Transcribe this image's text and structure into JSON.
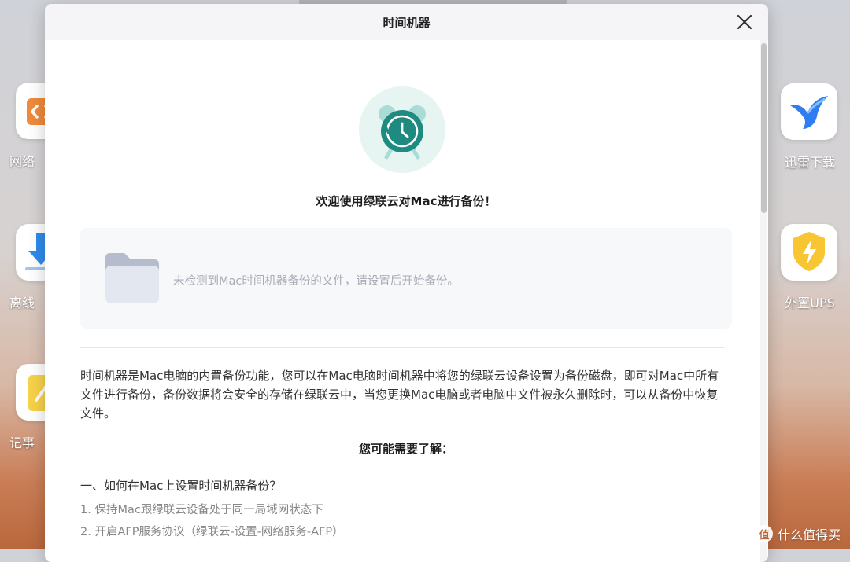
{
  "dialog": {
    "title": "时间机器",
    "welcome": "欢迎使用绿联云对Mac进行备份！",
    "empty_message": "未检测到Mac时间机器备份的文件，请设置后开始备份。",
    "description": "时间机器是Mac电脑的内置备份功能，您可以在Mac电脑时间机器中将您的绿联云设备设置为备份磁盘，即可对Mac中所有文件进行备份，备份数据将会安全的存储在绿联云中，当您更换Mac电脑或者电脑中文件被永久删除时，可以从备份中恢复文件。",
    "subheading": "您可能需要了解：",
    "section_title": "一、如何在Mac上设置时间机器备份？",
    "steps": [
      "1. 保持Mac跟绿联云设备处于同一局域网状态下",
      "2. 开启AFP服务协议（绿联云-设置-网络服务-AFP）"
    ]
  },
  "desktop": {
    "left_icons": [
      {
        "label": "网络",
        "icon": "remote-desktop-icon"
      },
      {
        "label": "离线",
        "icon": "download-arrow-icon"
      },
      {
        "label": "记事",
        "icon": "notes-icon"
      }
    ],
    "right_icons": [
      {
        "label": "迅雷下载",
        "icon": "thunder-bird-icon"
      },
      {
        "label": "外置UPS",
        "icon": "ups-shield-icon"
      }
    ]
  },
  "watermark": {
    "badge": "值",
    "text": "什么值得买"
  },
  "colors": {
    "accent": "#2f9c8f",
    "clock_teal": "#1f8a80",
    "ups_yellow": "#f7c632",
    "thunder_blue": "#2f7df0"
  }
}
